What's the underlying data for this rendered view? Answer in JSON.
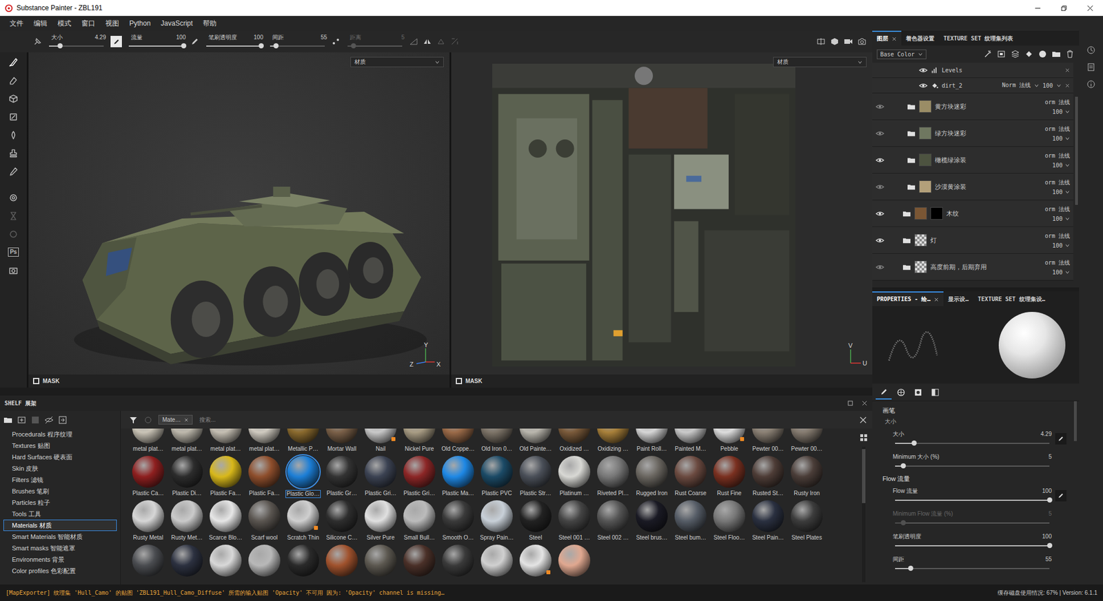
{
  "window": {
    "title": "Substance Painter - ZBL191"
  },
  "menu": [
    "文件",
    "编辑",
    "模式",
    "窗口",
    "视图",
    "Python",
    "JavaScript",
    "帮助"
  ],
  "toolbar": {
    "sliders": [
      {
        "label": "大小",
        "value": "4.29",
        "level": 0.2,
        "disabled": false
      },
      {
        "label": "流量",
        "value": "100",
        "level": 1,
        "disabled": false
      },
      {
        "label": "笔刷透明度",
        "value": "100",
        "level": 1,
        "disabled": false
      },
      {
        "label": "间距",
        "value": "55",
        "level": 0.1,
        "disabled": false
      },
      {
        "label": "距离",
        "value": "5",
        "level": 0.1,
        "disabled": true
      }
    ]
  },
  "tools": [
    {
      "selected": true,
      "disabled": false,
      "label": ""
    },
    {
      "selected": false,
      "disabled": false,
      "label": ""
    },
    {
      "selected": false,
      "disabled": false,
      "label": ""
    },
    {
      "selected": false,
      "disabled": false,
      "label": ""
    },
    {
      "selected": false,
      "disabled": false,
      "label": ""
    },
    {
      "selected": false,
      "disabled": false,
      "label": ""
    },
    {
      "selected": false,
      "disabled": false,
      "label": ""
    },
    {
      "selected": false,
      "disabled": false,
      "label": ""
    },
    {
      "selected": false,
      "disabled": true,
      "label": ""
    },
    {
      "selected": false,
      "disabled": true,
      "label": ""
    },
    {
      "selected": false,
      "disabled": false,
      "label": "Ps"
    },
    {
      "selected": false,
      "disabled": false,
      "label": ""
    }
  ],
  "viewports": [
    {
      "kind": "3d",
      "dropdown": "材质",
      "mask_label": "MASK",
      "mask_checked": false,
      "axes": [
        "Y",
        "Z",
        "X"
      ]
    },
    {
      "kind": "uv",
      "dropdown": "材质",
      "mask_label": "MASK",
      "mask_checked": false,
      "axes": [
        "V",
        "U"
      ]
    }
  ],
  "layers_panel": {
    "tabs": [
      {
        "label": "图层",
        "selected": true,
        "closable": true
      },
      {
        "label": "着色器设置",
        "selected": false,
        "closable": false
      },
      {
        "label": "TEXTURE SET 纹理集列表",
        "selected": false,
        "closable": false
      }
    ],
    "channel": "Base Color",
    "layers": [
      {
        "name": "Levels",
        "kind": "levels",
        "visible": true,
        "nested": true,
        "thumb": "",
        "mask": false,
        "blend": "",
        "opacity": ""
      },
      {
        "name": "dirt_2",
        "kind": "fill",
        "visible": true,
        "nested": true,
        "thumb": "",
        "mask": false,
        "blend": "Norm 法线",
        "opacity": "100"
      },
      {
        "name": "黄方块迷彩",
        "kind": "folder",
        "visible": false,
        "nested": true,
        "thumb": "#9a8d66",
        "mask": false,
        "blend": "orm 法线",
        "opacity": "100"
      },
      {
        "name": "绿方块迷彩",
        "kind": "folder",
        "visible": false,
        "nested": true,
        "thumb": "#6f7760",
        "mask": false,
        "blend": "orm 法线",
        "opacity": "100"
      },
      {
        "name": "橄榄绿涂装",
        "kind": "folder",
        "visible": true,
        "nested": true,
        "thumb": "#4d5340",
        "mask": false,
        "blend": "orm 法线",
        "opacity": "100"
      },
      {
        "name": "沙漠黄涂装",
        "kind": "folder",
        "visible": false,
        "nested": true,
        "thumb": "#b3a07a",
        "mask": false,
        "blend": "orm 法线",
        "opacity": "100"
      },
      {
        "name": "木纹",
        "kind": "folder",
        "visible": true,
        "nested": false,
        "thumb": "#7a5634",
        "mask": true,
        "blend": "orm 法线",
        "opacity": "100"
      },
      {
        "name": "灯",
        "kind": "folder",
        "visible": true,
        "nested": false,
        "thumb": "checker",
        "mask": false,
        "blend": "orm 法线",
        "opacity": "100"
      },
      {
        "name": "高度前期，后期弃用",
        "kind": "folder",
        "visible": false,
        "nested": false,
        "thumb": "checker",
        "mask": false,
        "blend": "orm 法线",
        "opacity": "100"
      }
    ]
  },
  "properties_panel": {
    "tabs": [
      {
        "label": "PROPERTIES - 绘…",
        "selected": true,
        "closable": true
      },
      {
        "label": "显示设…",
        "selected": false,
        "closable": false
      },
      {
        "label": "TEXTURE SET 纹理集设…",
        "selected": false,
        "closable": false
      }
    ],
    "subtabs": [
      {
        "selected": true
      },
      {
        "selected": false
      },
      {
        "selected": false
      },
      {
        "selected": false
      }
    ],
    "rows": [
      {
        "kind": "section",
        "label": "画笔",
        "value": "",
        "level": 0,
        "pressure": false,
        "disabled": false
      },
      {
        "kind": "sub",
        "label": "大小",
        "value": "",
        "level": 0,
        "pressure": false,
        "disabled": false
      },
      {
        "kind": "slider",
        "label": "大小",
        "value": "4.29",
        "level": 0.12,
        "pressure": true,
        "disabled": false
      },
      {
        "kind": "slider",
        "label": "Minimum 大小 (%)",
        "value": "5",
        "level": 0.05,
        "pressure": false,
        "disabled": false
      },
      {
        "kind": "section",
        "label": "Flow 流量",
        "value": "",
        "level": 0,
        "pressure": false,
        "disabled": false
      },
      {
        "kind": "slider",
        "label": "Flow 流量",
        "value": "100",
        "level": 1,
        "pressure": true,
        "disabled": false
      },
      {
        "kind": "slider",
        "label": "Minimum Flow 流量 (%)",
        "value": "5",
        "level": 0.05,
        "pressure": false,
        "disabled": true
      },
      {
        "kind": "slider",
        "label": "笔刷透明度",
        "value": "100",
        "level": 1,
        "pressure": false,
        "disabled": false
      },
      {
        "kind": "slider",
        "label": "间距",
        "value": "55",
        "level": 0.1,
        "pressure": false,
        "disabled": false
      }
    ]
  },
  "shelf": {
    "title": "SHELF 展架",
    "categories": [
      {
        "label": "Procedurals 程序纹理",
        "selected": false
      },
      {
        "label": "Textures 贴图",
        "selected": false
      },
      {
        "label": "Hard Surfaces 硬表面",
        "selected": false
      },
      {
        "label": "Skin 皮肤",
        "selected": false
      },
      {
        "label": "Filters 滤镜",
        "selected": false
      },
      {
        "label": "Brushes 笔刷",
        "selected": false
      },
      {
        "label": "Particles 粒子",
        "selected": false
      },
      {
        "label": "Tools 工具",
        "selected": false
      },
      {
        "label": "Materials 材质",
        "selected": true
      },
      {
        "label": "Smart Materials 智能材质",
        "selected": false
      },
      {
        "label": "Smart masks 智能遮罩",
        "selected": false
      },
      {
        "label": "Environments 背景",
        "selected": false
      },
      {
        "label": "Color profiles 色彩配置",
        "selected": false
      }
    ],
    "filter_chip": "Mate…",
    "search_placeholder": "搜索...",
    "materials": [
      {
        "label": "metal plat…",
        "color": "#c9c3b6",
        "selected": false,
        "badge": false
      },
      {
        "label": "metal plat…",
        "color": "#bdb8ac",
        "selected": false,
        "badge": false
      },
      {
        "label": "metal plat…",
        "color": "#c4beb2",
        "selected": false,
        "badge": false
      },
      {
        "label": "metal plat…",
        "color": "#cfcac0",
        "selected": false,
        "badge": false
      },
      {
        "label": "Metallic P…",
        "color": "#8a6a2e",
        "selected": false,
        "badge": false
      },
      {
        "label": "Mortar Wall",
        "color": "#7a6048",
        "selected": false,
        "badge": false
      },
      {
        "label": "Nail",
        "color": "#c8c8c8",
        "selected": false,
        "badge": true
      },
      {
        "label": "Nickel Pure",
        "color": "#a89c84",
        "selected": false,
        "badge": false
      },
      {
        "label": "Old Coppe…",
        "color": "#9a6a48",
        "selected": false,
        "badge": false
      },
      {
        "label": "Old Iron 0…",
        "color": "#7d7468",
        "selected": false,
        "badge": false
      },
      {
        "label": "Old Painte…",
        "color": "#b9b6ad",
        "selected": false,
        "badge": false
      },
      {
        "label": "Oxidized …",
        "color": "#7a5a3a",
        "selected": false,
        "badge": false
      },
      {
        "label": "Oxidizing …",
        "color": "#a8803a",
        "selected": false,
        "badge": false
      },
      {
        "label": "Paint Roll…",
        "color": "#d6d6d6",
        "selected": false,
        "badge": false
      },
      {
        "label": "Painted M…",
        "color": "#c9c9c9",
        "selected": false,
        "badge": false
      },
      {
        "label": "Pebble",
        "color": "#dcdcdc",
        "selected": false,
        "badge": true
      },
      {
        "label": "Pewter 00…",
        "color": "#8a8074",
        "selected": false,
        "badge": false
      },
      {
        "label": "Pewter 00…",
        "color": "#857b70",
        "selected": false,
        "badge": false
      },
      {
        "label": "Plastic Ca…",
        "color": "#8e1f1f",
        "selected": false,
        "badge": false
      },
      {
        "label": "Plastic Di…",
        "color": "#2c2c2c",
        "selected": false,
        "badge": false
      },
      {
        "label": "Plastic Fa…",
        "color": "#d8b81a",
        "selected": false,
        "badge": false
      },
      {
        "label": "Plastic Fa…",
        "color": "#8e4e2c",
        "selected": false,
        "badge": false
      },
      {
        "label": "Plastic Glo…",
        "color": "#1c7ed6",
        "selected": true,
        "badge": false
      },
      {
        "label": "Plastic Gr…",
        "color": "#333333",
        "selected": false,
        "badge": false
      },
      {
        "label": "Plastic Gri…",
        "color": "#3b4252",
        "selected": false,
        "badge": false
      },
      {
        "label": "Plastic Gri…",
        "color": "#8c2626",
        "selected": false,
        "badge": false
      },
      {
        "label": "Plastic Ma…",
        "color": "#1e88e5",
        "selected": false,
        "badge": false
      },
      {
        "label": "Plastic PVC",
        "color": "#1b4a66",
        "selected": false,
        "badge": false
      },
      {
        "label": "Plastic Str…",
        "color": "#4a4f58",
        "selected": false,
        "badge": false
      },
      {
        "label": "Platinum …",
        "color": "#d8d8d4",
        "selected": false,
        "badge": false
      },
      {
        "label": "Riveted Pl…",
        "color": "#777777",
        "selected": false,
        "badge": false
      },
      {
        "label": "Rugged Iron",
        "color": "#6a6660",
        "selected": false,
        "badge": false
      },
      {
        "label": "Rust Coarse",
        "color": "#6b4a40",
        "selected": false,
        "badge": false
      },
      {
        "label": "Rust Fine",
        "color": "#7a3020",
        "selected": false,
        "badge": false
      },
      {
        "label": "Rusted St…",
        "color": "#4d3c36",
        "selected": false,
        "badge": false
      },
      {
        "label": "Rusty Iron",
        "color": "#4a3d38",
        "selected": false,
        "badge": false
      },
      {
        "label": "Rusty Metal",
        "color": "#d6d6d6",
        "selected": false,
        "badge": false
      },
      {
        "label": "Rusty Met…",
        "color": "#cacaca",
        "selected": false,
        "badge": false
      },
      {
        "label": "Scarce Blo…",
        "color": "#e6e6e6",
        "selected": false,
        "badge": false
      },
      {
        "label": "Scarf wool",
        "color": "#5a5550",
        "selected": false,
        "badge": false
      },
      {
        "label": "Scratch Thin",
        "color": "#cfcfcf",
        "selected": false,
        "badge": true
      },
      {
        "label": "Silicone C…",
        "color": "#2e2e2e",
        "selected": false,
        "badge": false
      },
      {
        "label": "Silver Pure",
        "color": "#e0e0e0",
        "selected": false,
        "badge": false
      },
      {
        "label": "Small Bull…",
        "color": "#bbbbbb",
        "selected": false,
        "badge": false
      },
      {
        "label": "Smooth O…",
        "color": "#3a3a3a",
        "selected": false,
        "badge": false
      },
      {
        "label": "Spray Pain…",
        "color": "#c8d0d8",
        "selected": false,
        "badge": false
      },
      {
        "label": "Steel",
        "color": "#222222",
        "selected": false,
        "badge": false
      },
      {
        "label": "Steel 001 …",
        "color": "#444444",
        "selected": false,
        "badge": false
      },
      {
        "label": "Steel 002 …",
        "color": "#555555",
        "selected": false,
        "badge": false
      },
      {
        "label": "Steel brus…",
        "color": "#1a1a24",
        "selected": false,
        "badge": false
      },
      {
        "label": "Steel bum…",
        "color": "#555c66",
        "selected": false,
        "badge": false
      },
      {
        "label": "Steel Floo…",
        "color": "#777777",
        "selected": false,
        "badge": false
      },
      {
        "label": "Steel Pain…",
        "color": "#2a3040",
        "selected": false,
        "badge": false
      },
      {
        "label": "Steel Plates",
        "color": "#3c3c3c",
        "selected": false,
        "badge": false
      },
      {
        "label": "",
        "color": "#4a4c50",
        "selected": false,
        "badge": false
      },
      {
        "label": "",
        "color": "#2c3140",
        "selected": false,
        "badge": false
      },
      {
        "label": "",
        "color": "#d8d8d8",
        "selected": false,
        "badge": false
      },
      {
        "label": "",
        "color": "#b8b8b8",
        "selected": false,
        "badge": false
      },
      {
        "label": "",
        "color": "#2a2a2a",
        "selected": false,
        "badge": false
      },
      {
        "label": "",
        "color": "#a0522d",
        "selected": false,
        "badge": false
      },
      {
        "label": "",
        "color": "#5c5850",
        "selected": false,
        "badge": false
      },
      {
        "label": "",
        "color": "#4a3028",
        "selected": false,
        "badge": false
      },
      {
        "label": "",
        "color": "#3a3a3a",
        "selected": false,
        "badge": false
      },
      {
        "label": "",
        "color": "#d0d0d0",
        "selected": false,
        "badge": false
      },
      {
        "label": "",
        "color": "#e4e4e4",
        "selected": false,
        "badge": true
      },
      {
        "label": "",
        "color": "#e0a890",
        "selected": false,
        "badge": false
      }
    ]
  },
  "status_bar": {
    "message": "[MapExporter] 纹理集 'Hull_Camo' 的贴图 'ZBL191_Hull_Camo_Diffuse' 所需的输入贴图 'Opacity' 不可用 因为: 'Opacity' channel is missing…",
    "info": "缓存磁盘使用情况: 67% | Version: 6.1.1"
  }
}
